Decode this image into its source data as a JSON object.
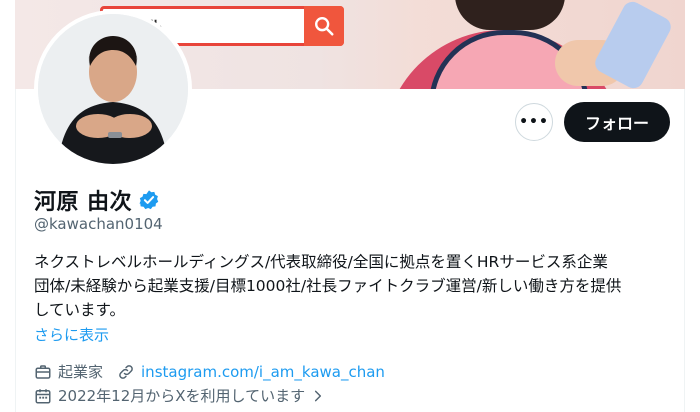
{
  "banner": {
    "search_text": "レベル"
  },
  "actions": {
    "more_label": "•••",
    "follow_label": "フォロー"
  },
  "profile": {
    "name": "河原 由次",
    "handle": "@kawachan0104",
    "bio_lines": [
      "ネクストレベルホールディングス/代表取締役/全国に拠点を置くHRサービス系企業",
      "団体/未経験から起業支援/目標1000社/社長ファイトクラブ運営/新しい働き方を提供",
      "しています。"
    ],
    "show_more": "さらに表示",
    "category": "起業家",
    "link": "instagram.com/i_am_kawa_chan",
    "joined": "2022年12月からXを利用しています"
  },
  "colors": {
    "accent": "#1d9bf0",
    "text": "#0f1419",
    "muted": "#536471",
    "follow_bg": "#0f1419",
    "banner_red": "#e8443a"
  },
  "icons": {
    "verified": "verified-badge-icon",
    "more": "more-dots-icon",
    "category": "briefcase-icon",
    "link": "link-icon",
    "joined": "calendar-icon",
    "chevron": "chevron-right-icon",
    "search": "search-icon"
  }
}
